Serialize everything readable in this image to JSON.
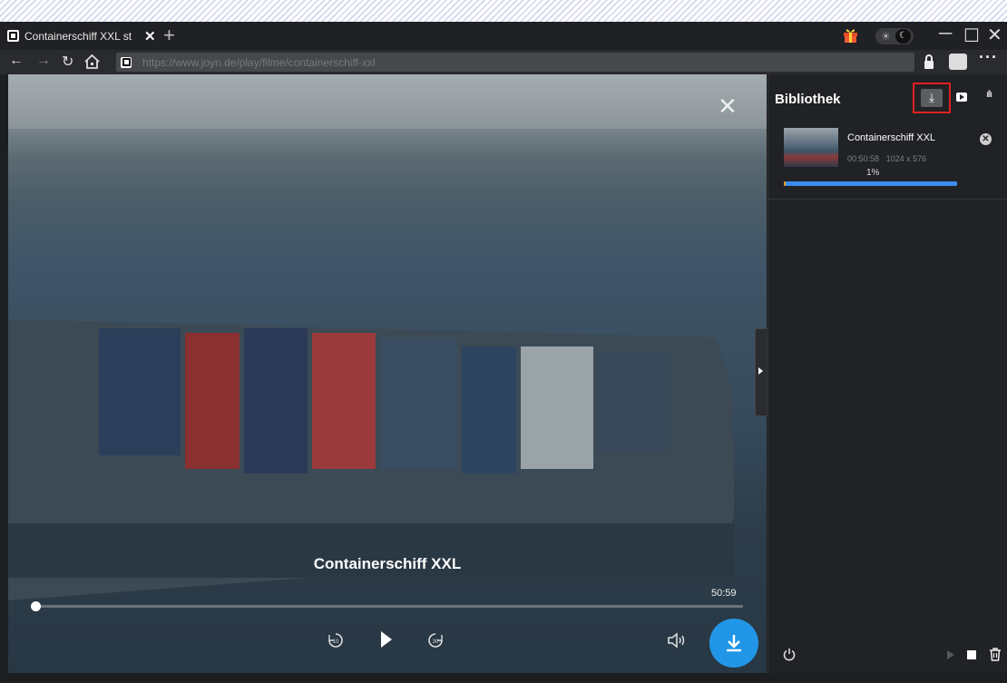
{
  "tab": {
    "title": "Containerschiff XXL st"
  },
  "address": {
    "url": "https://www.joyn.de/play/filme/containerschiff-xxl"
  },
  "player": {
    "title": "Containerschiff XXL",
    "duration": "50:59",
    "progress": 0
  },
  "library": {
    "title": "Bibliothek",
    "items": [
      {
        "title": "Containerschiff XXL",
        "length": "00:50:58",
        "resolution": "1024 x 576",
        "percent": "1%",
        "progress": 0.01
      }
    ]
  },
  "colors": {
    "accent": "#2196e6",
    "highlight": "#e02020",
    "progress_bar": "#3d8ef0"
  },
  "icons": [
    "gift-icon",
    "theme-toggle-icon",
    "minimize-icon",
    "maximize-icon",
    "close-icon",
    "back-icon",
    "forward-icon",
    "reload-icon",
    "home-icon",
    "lock-icon",
    "box-icon",
    "more-icon",
    "download-icon",
    "youtube-icon",
    "audio-icon",
    "power-icon",
    "play-icon",
    "stop-icon",
    "trash-icon",
    "rewind-10-icon",
    "forward-30-icon",
    "volume-icon"
  ]
}
